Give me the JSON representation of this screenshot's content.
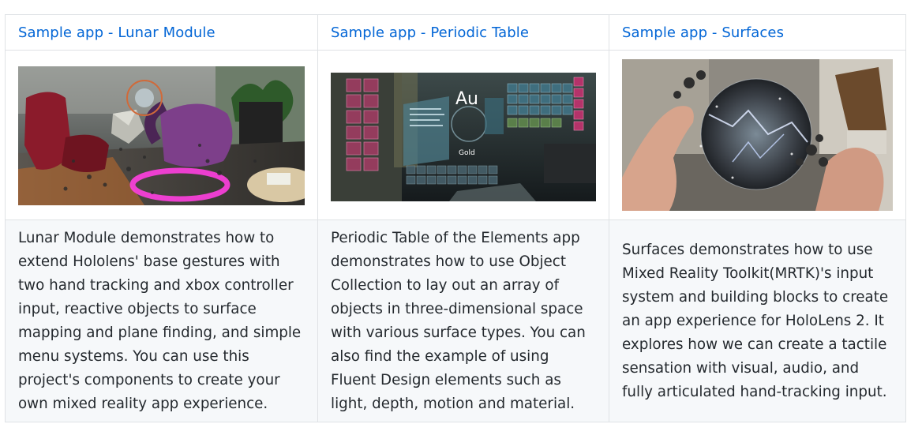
{
  "samples": [
    {
      "title": "Sample app - Lunar Module",
      "description": "Lunar Module demonstrates how to extend Hololens' base gestures with two hand tracking and xbox controller input, reactive objects to surface mapping and plane finding, and simple menu systems. You can use this project's components to create your own mixed reality app experience."
    },
    {
      "title": "Sample app - Periodic Table",
      "description": "Periodic Table of the Elements app demonstrates how to use Object Collection to lay out an array of objects in three-dimensional space with various surface types. You can also find the example of using Fluent Design elements such as light, depth, motion and material.",
      "image_text": {
        "symbol": "Au",
        "name": "Gold"
      }
    },
    {
      "title": "Sample app - Surfaces",
      "description": "Surfaces demonstrates how to use Mixed Reality Toolkit(MRTK)'s input system and building blocks to create an app experience for HoloLens 2. It explores how we can create a tactile sensation with visual, audio, and fully articulated hand-tracking input."
    }
  ],
  "colors": {
    "link": "#0366d6",
    "border": "#dfe2e5",
    "row_bg": "#f6f8fa"
  }
}
